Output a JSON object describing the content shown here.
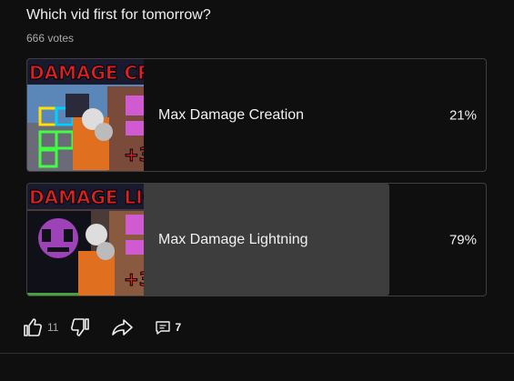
{
  "post": {
    "question": "Which vid first for tomorrow?",
    "votes": "666 votes"
  },
  "poll": {
    "options": [
      {
        "label": "Max Damage Creation",
        "percent_text": "21%",
        "percent": 21,
        "thumbnail_banner": "DAMAGE CREATION",
        "thumbnail_badge": "+3"
      },
      {
        "label": "Max Damage Lightning",
        "percent_text": "79%",
        "percent": 79,
        "thumbnail_banner": "DAMAGE LIGHTNING",
        "thumbnail_badge": "+3"
      }
    ]
  },
  "actions": {
    "like_count": "11",
    "comment_count": "7",
    "icons": [
      "thumbs-up-icon",
      "thumbs-down-icon",
      "share-icon",
      "comment-icon"
    ]
  },
  "colors": {
    "background": "#0f0f0f",
    "fill": "#3d3d3d",
    "border": "#3f3f3f",
    "text": "#f1f1f1",
    "muted": "#aaaaaa"
  }
}
